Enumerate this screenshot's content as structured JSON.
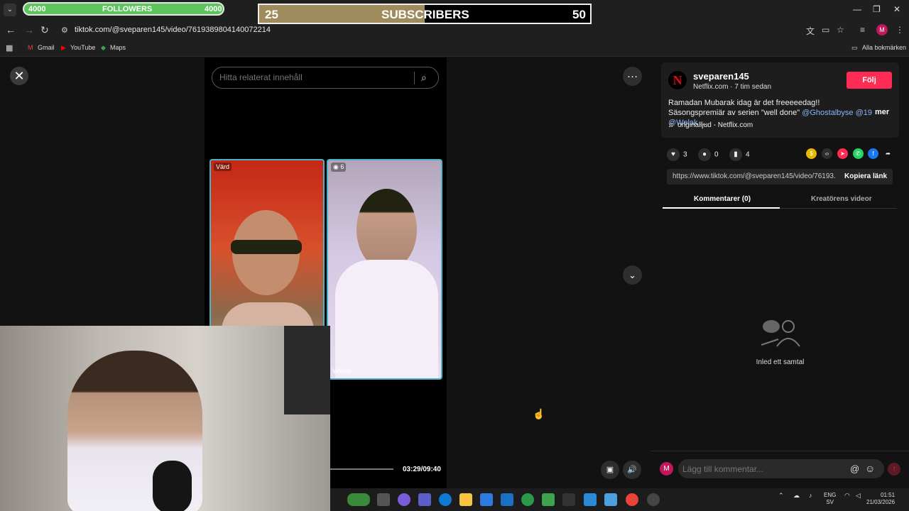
{
  "overlay": {
    "followers": {
      "left_value": "4000",
      "label": "FOLLOWERS",
      "right_value": "4000"
    },
    "subscribers": {
      "current": "25",
      "label": "SUBSCRIBERS",
      "goal": "50",
      "progress_fraction": 0.5
    }
  },
  "browser": {
    "url": "tiktok.com/@sveparen145/video/7619389804140072214",
    "bookmarks": [
      "Gmail",
      "YouTube",
      "Maps"
    ],
    "all_bookmarks": "Alla bokmärken",
    "profile_initial": "M"
  },
  "video": {
    "search_placeholder": "Hitta relaterat innehåll",
    "host_tag": "Värd",
    "guest_tag": "6",
    "guest_name": "Welak",
    "time": "03:29/09:40"
  },
  "panel": {
    "username": "sveparen145",
    "subline": "Netflix.com · 7 tim sedan",
    "follow_label": "Följ",
    "caption_text": "Ramadan Mubarak idag är det freeeeedag!! Säsongspremiär av serien \"well done\" ",
    "mention1": "@Ghostalbyse",
    "mention2": "@19",
    "mention3": "@Welak",
    "caption_end": " ...",
    "more_label": "mer",
    "music": "originalljud - Netflix.com",
    "likes": "3",
    "comments": "0",
    "saves": "4",
    "link": "https://www.tiktok.com/@sveparen145/video/76193...",
    "copy_label": "Kopiera länk",
    "tab_comments": "Kommentarer (0)",
    "tab_videos": "Kreatörens videor",
    "empty_text": "Inled ett samtal",
    "comment_placeholder": "Lägg till kommentar...",
    "me_initial": "M"
  },
  "taskbar": {
    "lang_top": "ENG",
    "lang_bottom": "SV",
    "clock_time": "01:51",
    "clock_date": "21/03/2026"
  }
}
